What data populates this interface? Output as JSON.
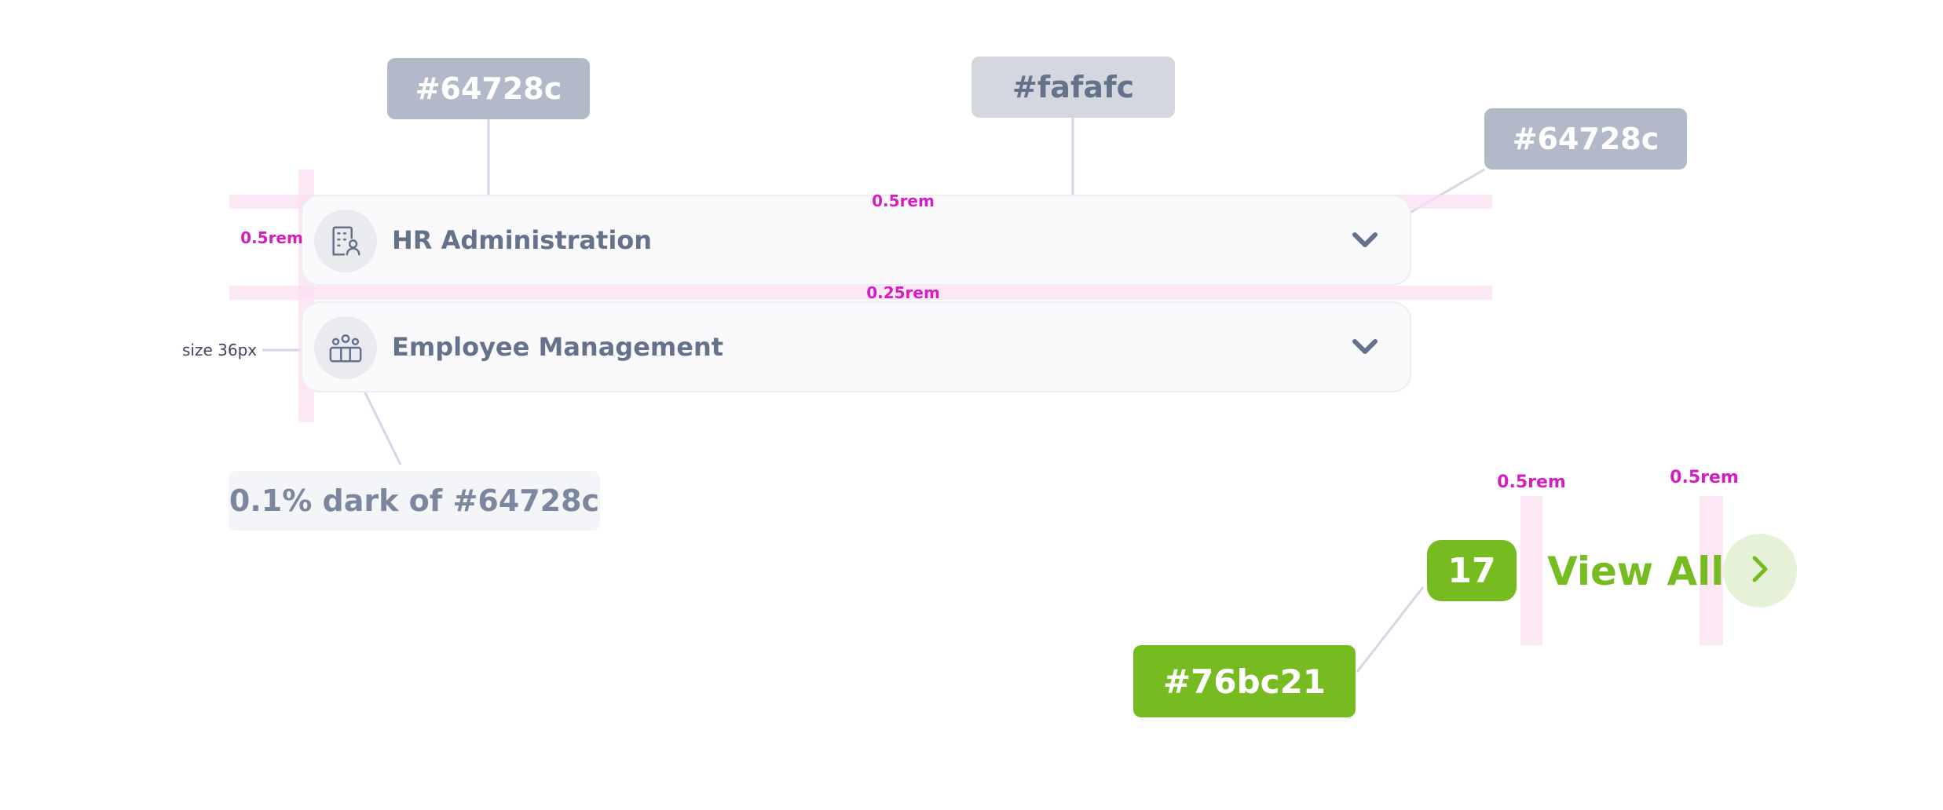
{
  "rows": [
    {
      "title": "HR Administration",
      "icon": "building-user-icon",
      "chevron": "chevron-down-icon"
    },
    {
      "title": "Employee Management",
      "icon": "users-group-icon",
      "chevron": "chevron-down-icon"
    }
  ],
  "annotations": {
    "icon_color": "#64728c",
    "row_background": "#fafafc",
    "chevron_color": "#64728c",
    "icon_background_note": "0.1% dark of #64728c",
    "badge_color": "#76bc21",
    "icon_size": "size 36px"
  },
  "spacing": {
    "row_top_padding": "0.5rem",
    "row_left_padding": "0.5rem",
    "row_gap": "0.25rem",
    "badge_gap": "0.5rem",
    "view_all_gap": "0.5rem"
  },
  "footer": {
    "count": "17",
    "view_all_label": "View All",
    "arrow": "chevron-right-icon"
  },
  "colors": {
    "text": "#64728c",
    "row_bg": "#fafafc",
    "accent": "#76bc21",
    "guide": "#fbdff0",
    "guide_text": "#d31fc0"
  }
}
